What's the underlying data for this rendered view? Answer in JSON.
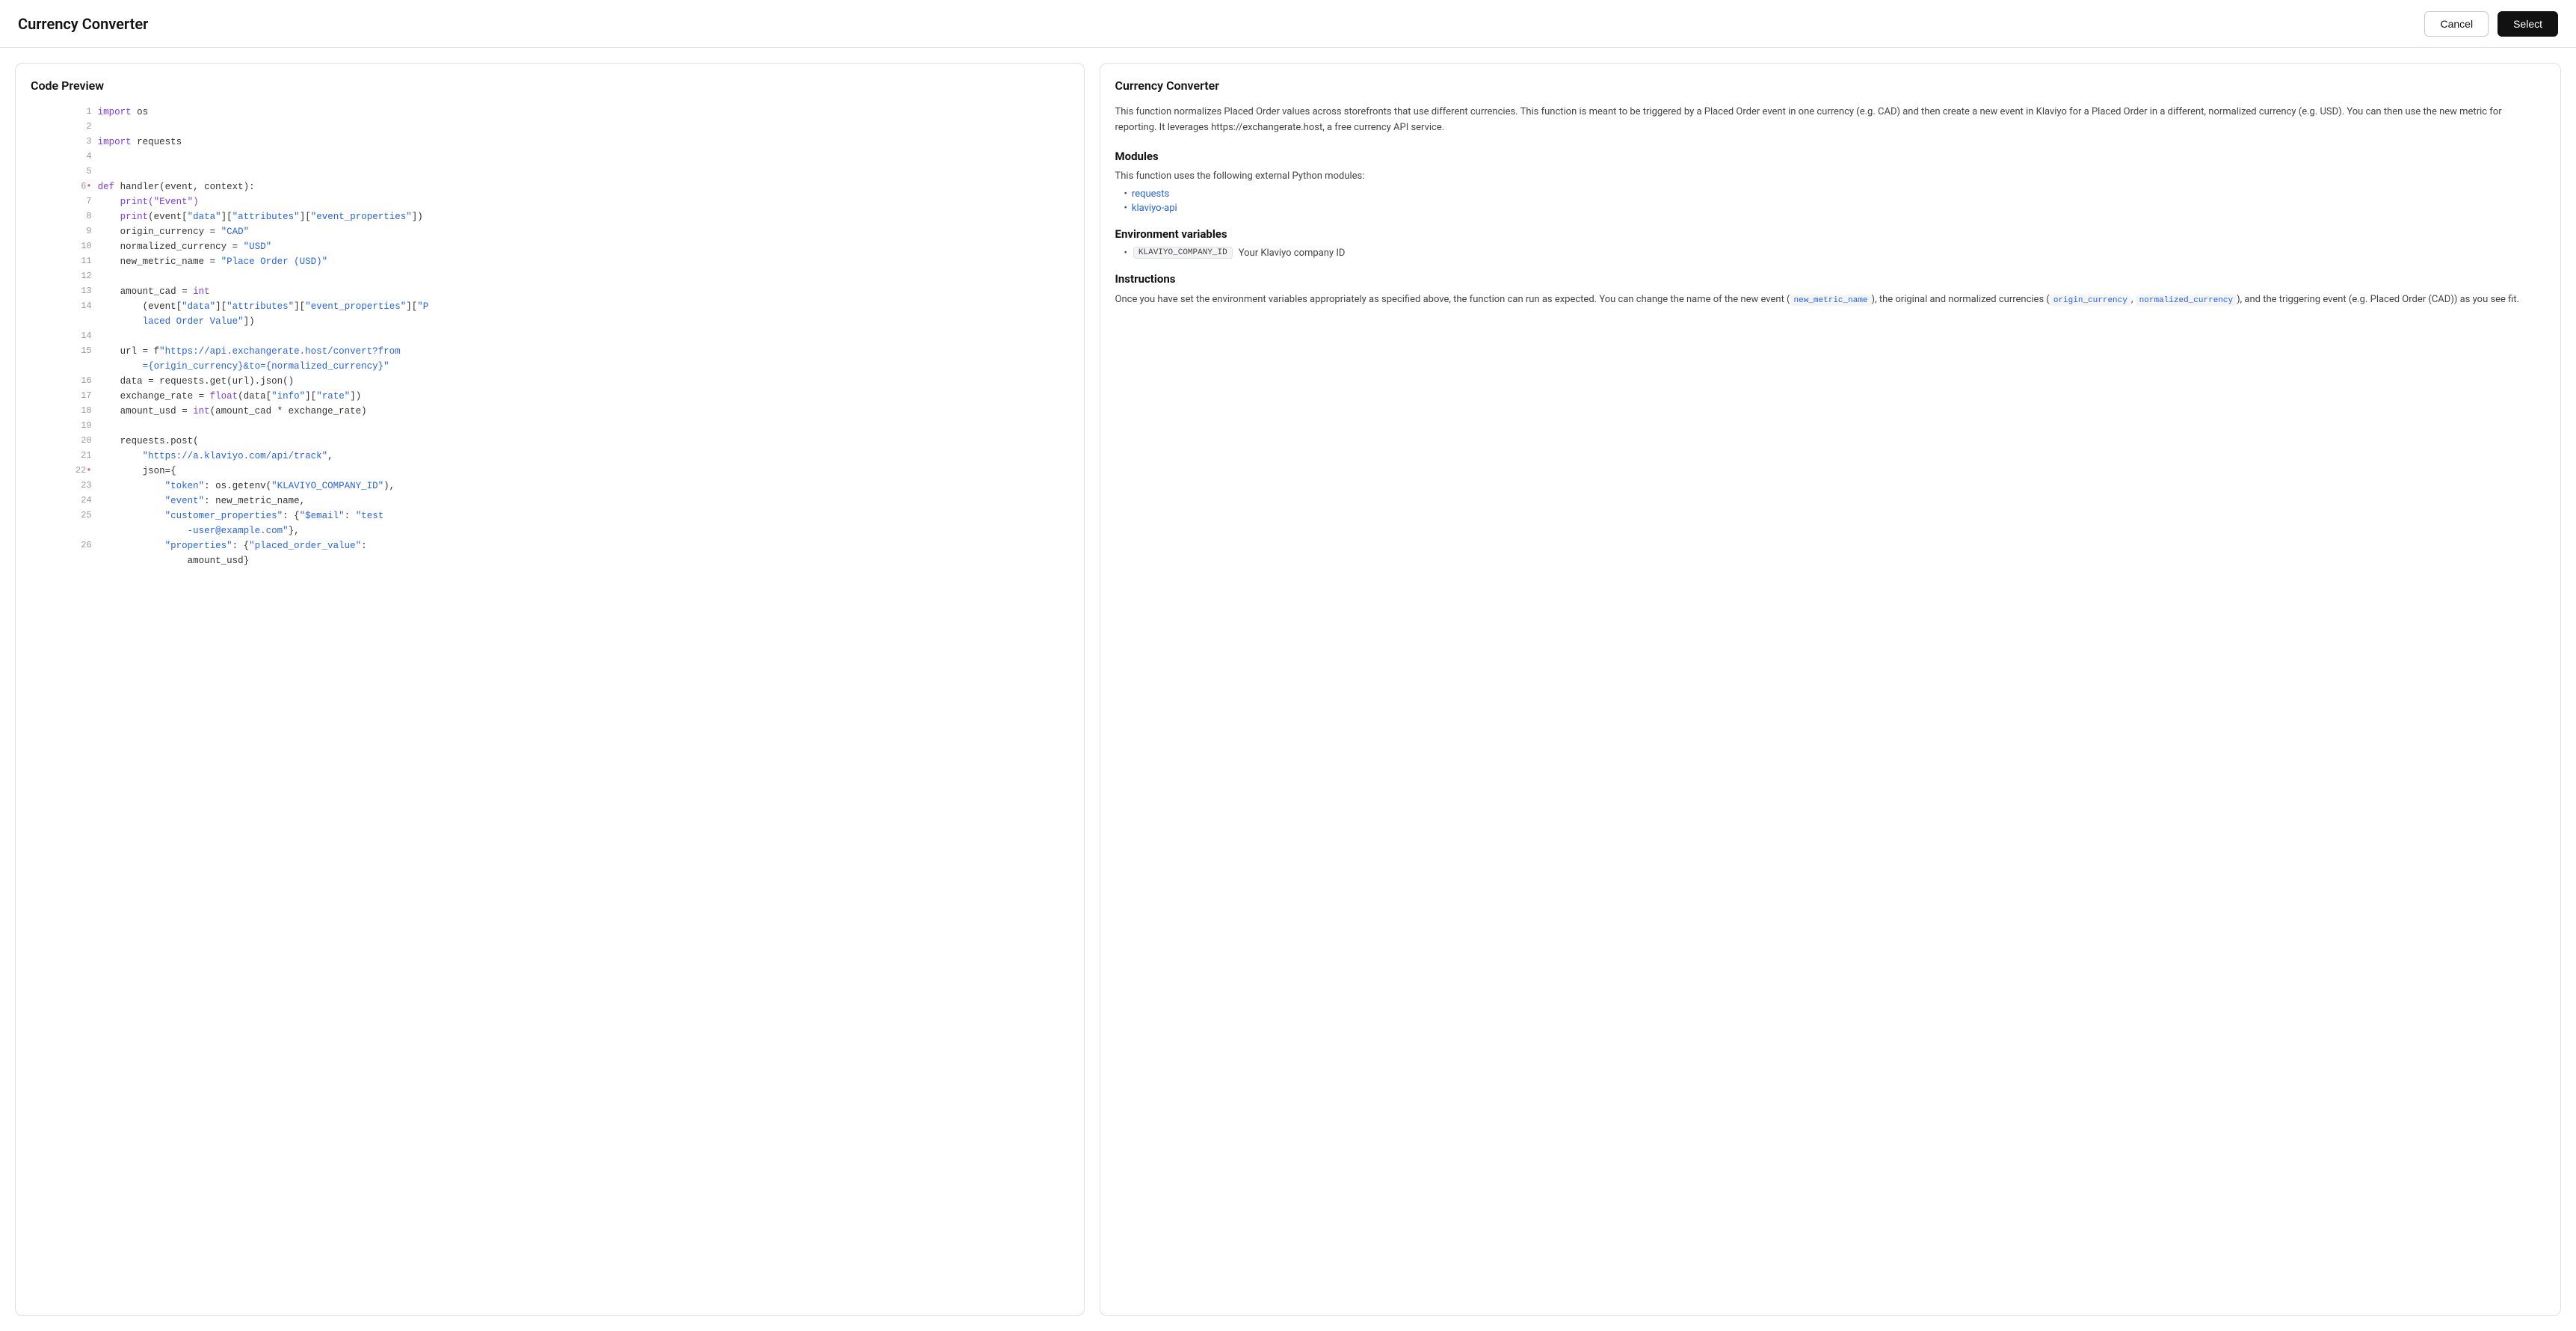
{
  "header": {
    "title": "Currency Converter",
    "cancel_label": "Cancel",
    "select_label": "Select"
  },
  "code_preview": {
    "title": "Code Preview",
    "lines": [
      {
        "num": "1",
        "dot": false,
        "content": [
          {
            "type": "kw",
            "text": "import"
          },
          {
            "type": "plain",
            "text": " os"
          }
        ]
      },
      {
        "num": "2",
        "dot": false,
        "content": []
      },
      {
        "num": "3",
        "dot": false,
        "content": [
          {
            "type": "kw",
            "text": "import"
          },
          {
            "type": "plain",
            "text": " requests"
          }
        ]
      },
      {
        "num": "4",
        "dot": false,
        "content": []
      },
      {
        "num": "5",
        "dot": false,
        "content": []
      },
      {
        "num": "6",
        "dot": true,
        "content": [
          {
            "type": "kw",
            "text": "def"
          },
          {
            "type": "plain",
            "text": " handler(event, context):"
          }
        ]
      },
      {
        "num": "7",
        "dot": false,
        "content": [
          {
            "type": "plain",
            "text": "    "
          },
          {
            "type": "fn",
            "text": "print"
          },
          {
            "type": "fn",
            "text": "(\"Event\")"
          }
        ]
      },
      {
        "num": "8",
        "dot": false,
        "content": [
          {
            "type": "plain",
            "text": "    "
          },
          {
            "type": "fn",
            "text": "print"
          },
          {
            "type": "plain",
            "text": "(event["
          },
          {
            "type": "str",
            "text": "\"data\""
          },
          {
            "type": "plain",
            "text": "]["
          },
          {
            "type": "str",
            "text": "\"attributes\""
          },
          {
            "type": "plain",
            "text": "]["
          },
          {
            "type": "str",
            "text": "\"event_properties\""
          },
          {
            "type": "plain",
            "text": "])"
          }
        ]
      },
      {
        "num": "9",
        "dot": false,
        "content": [
          {
            "type": "plain",
            "text": "    origin_currency = "
          },
          {
            "type": "str",
            "text": "\"CAD\""
          }
        ]
      },
      {
        "num": "10",
        "dot": false,
        "content": [
          {
            "type": "plain",
            "text": "    normalized_currency = "
          },
          {
            "type": "str",
            "text": "\"USD\""
          }
        ]
      },
      {
        "num": "11",
        "dot": false,
        "content": [
          {
            "type": "plain",
            "text": "    new_metric_name = "
          },
          {
            "type": "str",
            "text": "\"Place Order (USD)\""
          }
        ]
      },
      {
        "num": "12",
        "dot": false,
        "content": []
      },
      {
        "num": "13",
        "dot": false,
        "content": [
          {
            "type": "plain",
            "text": "    amount_cad = "
          },
          {
            "type": "kw",
            "text": "int"
          }
        ]
      },
      {
        "num": "14",
        "dot": false,
        "content": [
          {
            "type": "plain",
            "text": "        (event["
          },
          {
            "type": "str",
            "text": "\"data\""
          },
          {
            "type": "plain",
            "text": "]["
          },
          {
            "type": "str",
            "text": "\"attributes\""
          },
          {
            "type": "plain",
            "text": "]["
          },
          {
            "type": "str",
            "text": "\"event_properties\""
          },
          {
            "type": "plain",
            "text": "]["
          },
          {
            "type": "str",
            "text": "\"P"
          }
        ]
      },
      {
        "num": "",
        "dot": false,
        "content": [
          {
            "type": "plain",
            "text": "        "
          },
          {
            "type": "str",
            "text": "laced Order Value\""
          },
          {
            "type": "plain",
            "text": "])"
          }
        ]
      },
      {
        "num": "14",
        "dot": false,
        "content": []
      },
      {
        "num": "15",
        "dot": false,
        "content": [
          {
            "type": "plain",
            "text": "    url = f"
          },
          {
            "type": "str",
            "text": "\"https://api.exchangerate.host/convert?from"
          },
          {
            "type": "plain",
            "text": ""
          }
        ]
      },
      {
        "num": "",
        "dot": false,
        "content": [
          {
            "type": "plain",
            "text": "        "
          },
          {
            "type": "str",
            "text": "={origin_currency}&to={normalized_currency}\""
          }
        ]
      },
      {
        "num": "16",
        "dot": false,
        "content": [
          {
            "type": "plain",
            "text": "    data = requests.get(url).json()"
          }
        ]
      },
      {
        "num": "17",
        "dot": false,
        "content": [
          {
            "type": "plain",
            "text": "    exchange_rate = "
          },
          {
            "type": "kw",
            "text": "float"
          },
          {
            "type": "plain",
            "text": "(data["
          },
          {
            "type": "str",
            "text": "\"info\""
          },
          {
            "type": "plain",
            "text": "]["
          },
          {
            "type": "str",
            "text": "\"rate\""
          },
          {
            "type": "plain",
            "text": "])"
          }
        ]
      },
      {
        "num": "18",
        "dot": false,
        "content": [
          {
            "type": "plain",
            "text": "    amount_usd = "
          },
          {
            "type": "kw",
            "text": "int"
          },
          {
            "type": "plain",
            "text": "(amount_cad * exchange_rate)"
          }
        ]
      },
      {
        "num": "19",
        "dot": false,
        "content": []
      },
      {
        "num": "20",
        "dot": false,
        "content": [
          {
            "type": "plain",
            "text": "    requests.post("
          }
        ]
      },
      {
        "num": "21",
        "dot": false,
        "content": [
          {
            "type": "plain",
            "text": "        "
          },
          {
            "type": "str",
            "text": "\"https://a.klaviyo.com/api/track\""
          },
          {
            "type": "plain",
            "text": ","
          }
        ]
      },
      {
        "num": "22",
        "dot": true,
        "content": [
          {
            "type": "plain",
            "text": "        json={"
          }
        ]
      },
      {
        "num": "23",
        "dot": false,
        "content": [
          {
            "type": "plain",
            "text": "            "
          },
          {
            "type": "str",
            "text": "\"token\""
          },
          {
            "type": "plain",
            "text": ": os.getenv("
          },
          {
            "type": "str",
            "text": "\"KLAVIYO_COMPANY_ID\""
          },
          {
            "type": "plain",
            "text": "),"
          }
        ]
      },
      {
        "num": "24",
        "dot": false,
        "content": [
          {
            "type": "plain",
            "text": "            "
          },
          {
            "type": "str",
            "text": "\"event\""
          },
          {
            "type": "plain",
            "text": ": new_metric_name,"
          }
        ]
      },
      {
        "num": "25",
        "dot": false,
        "content": [
          {
            "type": "plain",
            "text": "            "
          },
          {
            "type": "str",
            "text": "\"customer_properties\""
          },
          {
            "type": "plain",
            "text": ": {"
          },
          {
            "type": "str",
            "text": "\"$email\""
          },
          {
            "type": "plain",
            "text": ": "
          },
          {
            "type": "str",
            "text": "\"test"
          },
          {
            "type": "plain",
            "text": ""
          }
        ]
      },
      {
        "num": "",
        "dot": false,
        "content": [
          {
            "type": "plain",
            "text": "                "
          },
          {
            "type": "str",
            "text": "-user@example.com\""
          },
          {
            "type": "plain",
            "text": "},"
          }
        ]
      },
      {
        "num": "26",
        "dot": false,
        "content": [
          {
            "type": "plain",
            "text": "            "
          },
          {
            "type": "str",
            "text": "\"properties\""
          },
          {
            "type": "plain",
            "text": ": {"
          },
          {
            "type": "str",
            "text": "\"placed_order_value\""
          },
          {
            "type": "plain",
            "text": ":"
          }
        ]
      },
      {
        "num": "",
        "dot": false,
        "content": [
          {
            "type": "plain",
            "text": "                amount_usd}"
          }
        ]
      }
    ]
  },
  "readme": {
    "title": "Currency Converter",
    "description": "This function normalizes Placed Order values across storefronts that use different currencies. This function is meant to be triggered by a Placed Order event in one currency (e.g. CAD) and then create a new event in Klaviyo for a Placed Order in a different, normalized currency (e.g. USD). You can then use the new metric for reporting. It leverages https://exchangerate.host, a free currency API service.",
    "modules_title": "Modules",
    "modules_desc": "This function uses the following external Python modules:",
    "modules": [
      "requests",
      "klaviyo-api"
    ],
    "env_title": "Environment variables",
    "env_vars": [
      {
        "name": "KLAVIYO_COMPANY_ID",
        "desc": "Your Klaviyo company ID"
      }
    ],
    "instructions_title": "Instructions",
    "instructions_text": "Once you have set the environment variables appropriately as specified above, the function can run as expected. You can change the name of the new event (",
    "instructions_inline1": "new_metric_name",
    "instructions_text2": "), the original and normalized currencies (",
    "instructions_inline2": "origin_currency",
    "instructions_text3": ",",
    "instructions_inline3": "normalized_currency",
    "instructions_text4": "), and the triggering event (e.g. Placed Order (CAD)) as you see fit."
  }
}
